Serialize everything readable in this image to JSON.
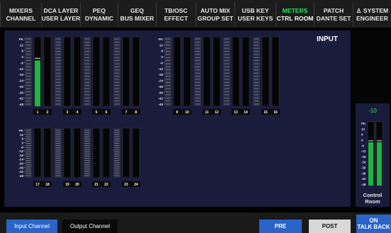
{
  "tabs": [
    {
      "l1": "MIXERS",
      "l2": "CHANNEL",
      "active": false
    },
    {
      "l1": "DCA LAYER",
      "l2": "USER LAYER",
      "active": false
    },
    {
      "l1": "PEQ",
      "l2": "DYNAMIC",
      "active": false
    },
    {
      "l1": "GEQ",
      "l2": "BUS MIXER",
      "active": false
    },
    {
      "l1": "TB/OSC",
      "l2": "EFFECT",
      "active": false
    },
    {
      "l1": "AUTO MIX",
      "l2": "GROUP SET",
      "active": false
    },
    {
      "l1": "USB KEY",
      "l2": "USER KEYS",
      "active": false
    },
    {
      "l1": "METERS",
      "l2": "CTRL ROOM",
      "active": true
    },
    {
      "l1": "PATCH",
      "l2": "DANTE SET",
      "active": false
    },
    {
      "l1": "♙ SYSTEM",
      "l2": "ENGINEER",
      "active": false
    }
  ],
  "meters": {
    "section_title": "INPUT",
    "scale_labels": [
      "PK",
      "12",
      "6",
      "0",
      "-6",
      "-12",
      "-18",
      "-24",
      "-30",
      "-36",
      "-42",
      "-48"
    ],
    "channel_pairs": [
      {
        "labels": [
          "1",
          "2"
        ],
        "levels": [
          0.66,
          0.0
        ]
      },
      {
        "labels": [
          "3",
          "4"
        ],
        "levels": [
          0.0,
          0.0
        ]
      },
      {
        "labels": [
          "5",
          "6"
        ],
        "levels": [
          0.0,
          0.0
        ]
      },
      {
        "labels": [
          "7",
          "8"
        ],
        "levels": [
          0.0,
          0.0
        ]
      },
      {
        "labels": [
          "9",
          "10"
        ],
        "levels": [
          0.0,
          0.0
        ]
      },
      {
        "labels": [
          "11",
          "12"
        ],
        "levels": [
          0.0,
          0.0
        ]
      },
      {
        "labels": [
          "13",
          "14"
        ],
        "levels": [
          0.0,
          0.0
        ]
      },
      {
        "labels": [
          "15",
          "16"
        ],
        "levels": [
          0.0,
          0.0
        ]
      },
      {
        "labels": [
          "17",
          "18"
        ],
        "levels": [
          0.0,
          0.0
        ]
      },
      {
        "labels": [
          "19",
          "20"
        ],
        "levels": [
          0.0,
          0.0
        ]
      },
      {
        "labels": [
          "21",
          "22"
        ],
        "levels": [
          0.0,
          0.0
        ]
      },
      {
        "labels": [
          "23",
          "24"
        ],
        "levels": [
          0.0,
          0.0
        ]
      }
    ]
  },
  "control_room": {
    "value": "-10",
    "label_line1": "Control",
    "label_line2": "Room",
    "levels": [
      0.68,
      0.68
    ]
  },
  "bottom": {
    "input_channel": "Input Channel",
    "output_channel": "Output Channel",
    "pre": "PRE",
    "post": "POST",
    "talkback_state": "ON",
    "talkback_label": "TALK BACK"
  },
  "colors": {
    "meter_green": "#1fb545",
    "active_tab": "#33e061",
    "button_blue": "#2a64c8",
    "panel_navy": "#1a1c3c"
  }
}
